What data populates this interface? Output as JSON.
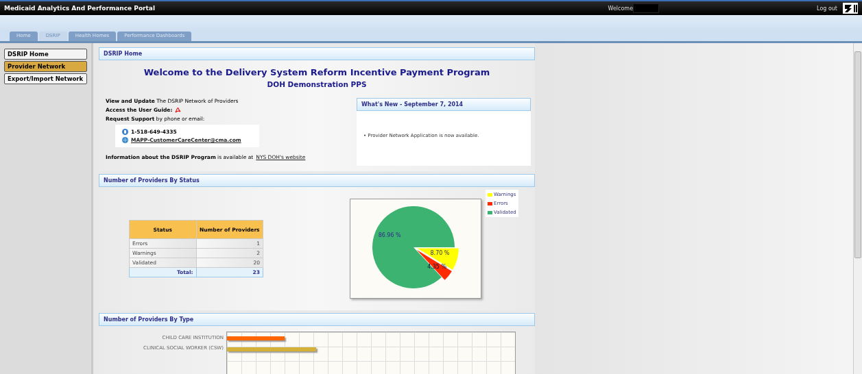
{
  "header": {
    "title": "Medicaid Analytics And Performance Portal",
    "welcome": "Welcome",
    "logout": "Log out"
  },
  "tabs": [
    {
      "label": "Home",
      "selected": false
    },
    {
      "label": "DSRIP",
      "selected": true
    },
    {
      "label": "Health Homes",
      "selected": false
    },
    {
      "label": "Performance Dashboards",
      "selected": false
    }
  ],
  "sidebar": {
    "items": [
      {
        "label": "DSRIP Home",
        "selected": false
      },
      {
        "label": "Provider Network",
        "selected": true
      },
      {
        "label": "Export/Import Network",
        "selected": false
      }
    ]
  },
  "home": {
    "panel_title": "DSRIP Home",
    "heading": "Welcome to the Delivery System Reform Incentive Payment Program",
    "subheading": "DOH Demonstration PPS",
    "lines": [
      {
        "kind": "text",
        "text": "**View and Update** The DSRIP Network of Providers"
      },
      {
        "kind": "guide",
        "text": "**Access the User Guide:**"
      },
      {
        "kind": "text",
        "text": "**Request Support** by phone or email:"
      }
    ],
    "phone": "1-518-649-4335",
    "email": "MAPP-CustomerCareCenter@cma.com",
    "info": "**Information about the DSRIP Program** is available at",
    "info_link": "NYS DOH's website",
    "news": {
      "title": "What's New - September 7, 2014",
      "items": [
        "• Provider Network Application is now available."
      ]
    }
  },
  "status": {
    "panel_title": "Number of Providers By Status",
    "columns": [
      "Status",
      "Number of Providers"
    ],
    "rows": [
      {
        "status": "Errors",
        "count": "1"
      },
      {
        "status": "Warnings",
        "count": "2"
      },
      {
        "status": "Validated",
        "count": "20"
      }
    ],
    "total_label": "Total:",
    "total": "23",
    "chart_data": {
      "type": "pie",
      "categories": [
        "Warnings",
        "Errors",
        "Validated"
      ],
      "values": [
        8.7,
        4.35,
        86.96
      ],
      "colors": [
        "#ffff00",
        "#ff2a00",
        "#3cb371"
      ],
      "value_labels": [
        "8.70 %",
        "4.35 %",
        "86.96 %"
      ]
    }
  },
  "types": {
    "panel_title": "Number of Providers By Type",
    "categories": [
      {
        "label": "CHILD CARE INSTITUTION",
        "color": "#ff6600"
      },
      {
        "label": "CLINICAL SOCIAL WORKER (CSW)",
        "color": "#d4b23a"
      }
    ]
  }
}
